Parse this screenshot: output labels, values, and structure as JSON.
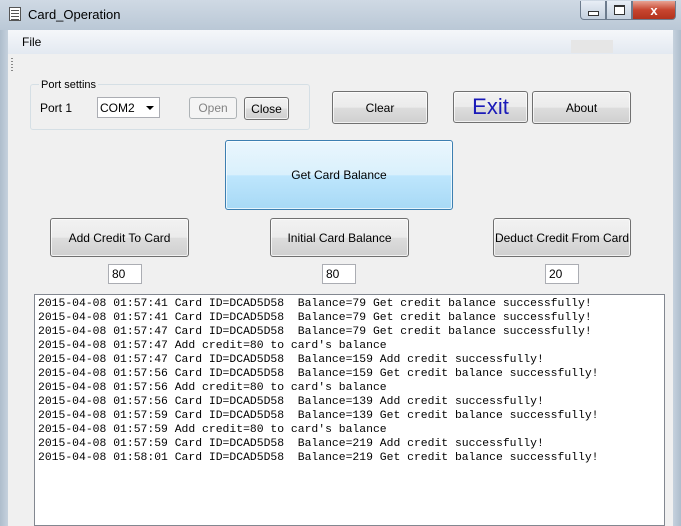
{
  "window": {
    "title": "Card_Operation",
    "controls": {
      "minimize": "minimize",
      "maximize": "maximize",
      "close": "x"
    }
  },
  "menu": {
    "file": "File"
  },
  "port": {
    "group_label": "Port settins",
    "port_label": "Port 1",
    "selected": "COM2",
    "open_label": "Open",
    "close_label": "Close"
  },
  "toolbar": {
    "clear_label": "Clear",
    "exit_label": "Exit",
    "about_label": "About",
    "exit_color": "#1a1ab8"
  },
  "actions": {
    "get_balance_label": "Get Card Balance",
    "add_credit_label": "Add Credit To Card",
    "initial_balance_label": "Initial Card Balance",
    "deduct_credit_label": "Deduct Credit From Card",
    "add_credit_value": "80",
    "initial_balance_value": "80",
    "deduct_credit_value": "20"
  },
  "log": [
    "2015-04-08 01:57:41 Card ID=DCAD5D58  Balance=79 Get credit balance successfully!",
    "2015-04-08 01:57:41 Card ID=DCAD5D58  Balance=79 Get credit balance successfully!",
    "2015-04-08 01:57:47 Card ID=DCAD5D58  Balance=79 Get credit balance successfully!",
    "2015-04-08 01:57:47 Add credit=80 to card's balance",
    "2015-04-08 01:57:47 Card ID=DCAD5D58  Balance=159 Add credit successfully!",
    "2015-04-08 01:57:56 Card ID=DCAD5D58  Balance=159 Get credit balance successfully!",
    "2015-04-08 01:57:56 Add credit=80 to card's balance",
    "2015-04-08 01:57:56 Card ID=DCAD5D58  Balance=139 Add credit successfully!",
    "2015-04-08 01:57:59 Card ID=DCAD5D58  Balance=139 Get credit balance successfully!",
    "2015-04-08 01:57:59 Add credit=80 to card's balance",
    "2015-04-08 01:57:59 Card ID=DCAD5D58  Balance=219 Add credit successfully!",
    "2015-04-08 01:58:01 Card ID=DCAD5D58  Balance=219 Get credit balance successfully!"
  ]
}
